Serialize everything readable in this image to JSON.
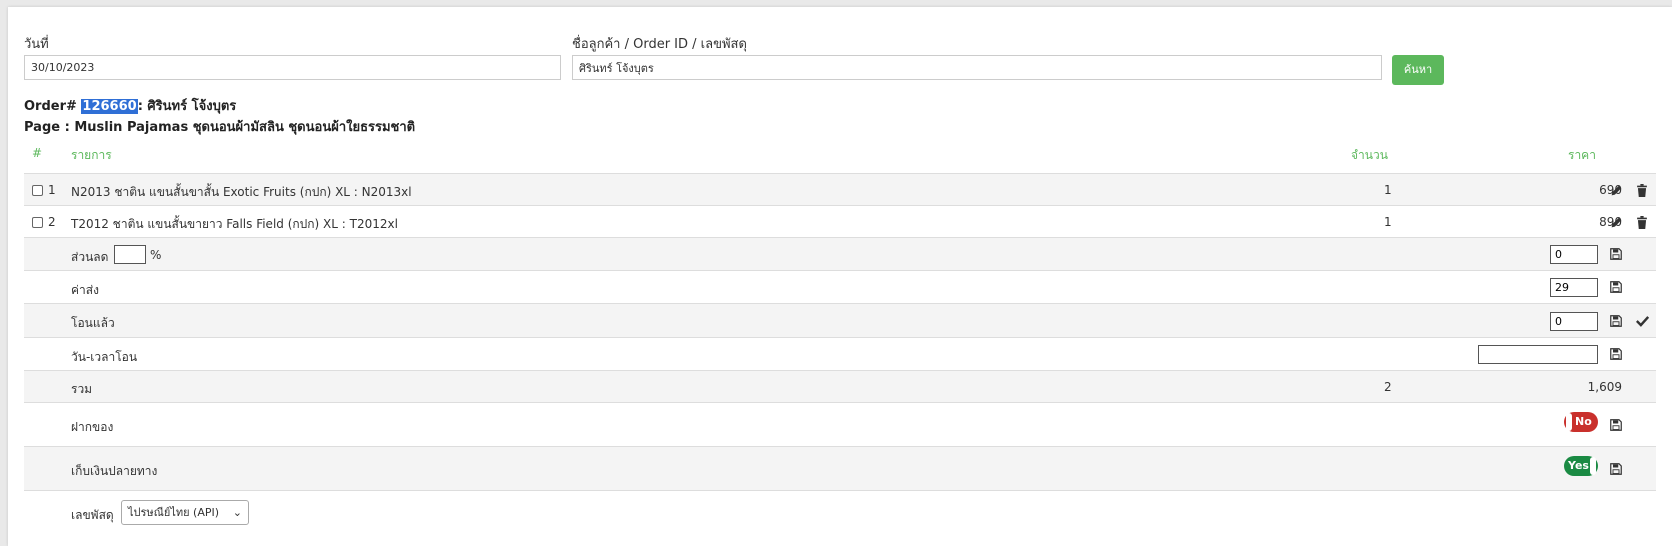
{
  "search": {
    "date_label": "วันที่",
    "date_value": "30/10/2023",
    "customer_label": "ชื่อลูกค้า / Order ID / เลขพัสดุ",
    "customer_value": "ศิรินทร์ โจ้งบุตร",
    "search_button": "ค้นหา"
  },
  "order": {
    "prefix": "Order#",
    "id": "126660",
    "name_suffix": ": ศิรินทร์ โจ้งบุตร",
    "page_line": "Page : Muslin Pajamas ชุดนอนผ้ามัสลิน ชุดนอนผ้าใยธรรมชาติ"
  },
  "table": {
    "headers": {
      "num": "#",
      "item": "รายการ",
      "qty": "จำนวน",
      "price": "ราคา"
    },
    "items": [
      {
        "num": "1",
        "name": "N2013 ชาติน แขนสั้นขาสั้น Exotic Fruits (กปก) XL : N2013xl",
        "qty": "1",
        "price": "690"
      },
      {
        "num": "2",
        "name": "T2012 ชาติน แขนสั้นขายาว Falls Field (กปก) XL : T2012xl",
        "qty": "1",
        "price": "890"
      }
    ],
    "discount_label": "ส่วนลด",
    "discount_percent": "",
    "percent_sign": "%",
    "discount_value": "0",
    "shipping_label": "ค่าส่ง",
    "shipping_value": "29",
    "paid_label": "โอนแล้ว",
    "paid_value": "0",
    "transfer_time_label": "วัน-เวลาโอน",
    "transfer_time_value": "",
    "total_label": "รวม",
    "total_qty": "2",
    "total_price": "1,609",
    "gift_label": "ฝากของ",
    "gift_toggle": "No",
    "cod_label": "เก็บเงินปลายทาง",
    "cod_toggle": "Yes",
    "tracking_label": "เลขพัสดุ",
    "tracking_option": "ไปรษณีย์ไทย (API)"
  },
  "colors": {
    "accent": "#5cb85c",
    "no": "#c9302c",
    "yes": "#1a8a43",
    "highlight": "#2f6fd6"
  }
}
